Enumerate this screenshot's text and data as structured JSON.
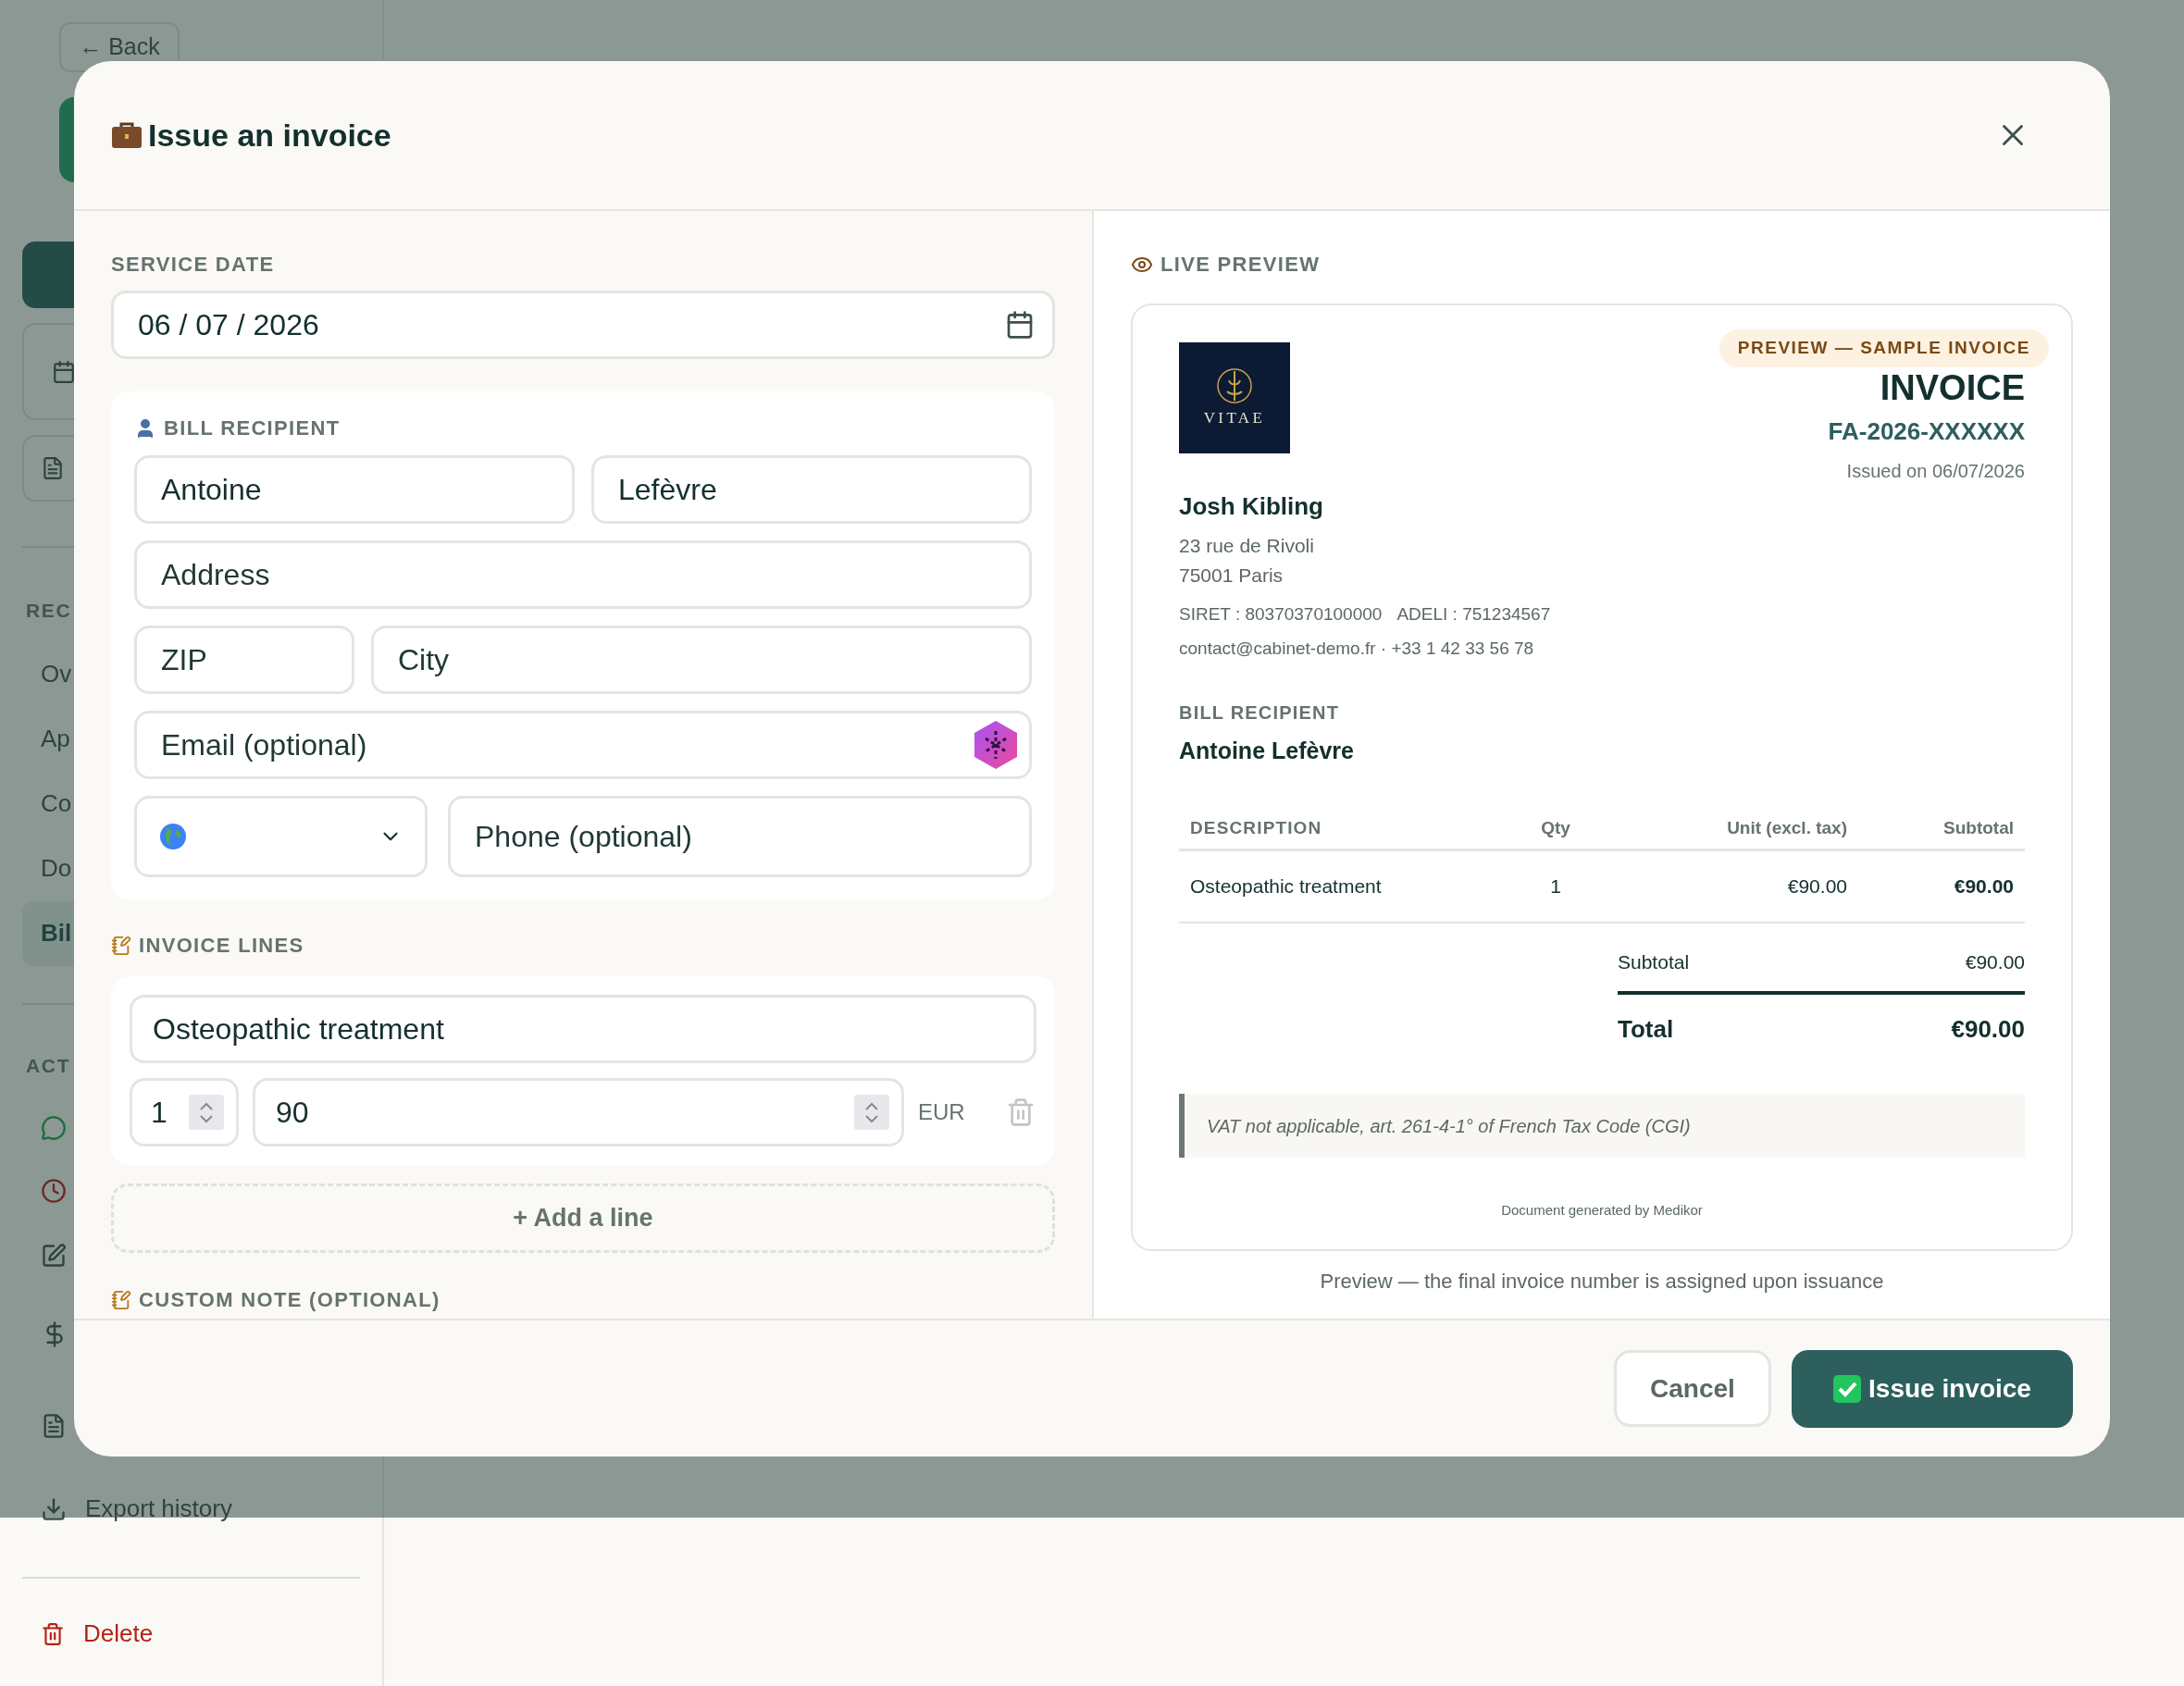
{
  "background": {
    "back_button": "← Back",
    "sections": [
      {
        "heading": "REC",
        "items": [
          {
            "label": "Ov",
            "selected": false
          },
          {
            "label": "Ap",
            "selected": false
          },
          {
            "label": "Co",
            "selected": false
          },
          {
            "label": "Do",
            "selected": false
          },
          {
            "label": "Bil",
            "selected": true
          }
        ]
      },
      {
        "heading": "ACT"
      }
    ],
    "export_label": "Export history",
    "delete_label": "Delete"
  },
  "dialog": {
    "title": "Issue an invoice",
    "form": {
      "service_date": {
        "label": "SERVICE DATE",
        "value": "06 / 07 / 2026"
      },
      "recipient": {
        "heading": "BILL RECIPIENT",
        "first_name": {
          "value": "Antoine"
        },
        "last_name": {
          "value": "Lefèvre"
        },
        "address": {
          "placeholder": "Address"
        },
        "zip": {
          "placeholder": "ZIP"
        },
        "city": {
          "placeholder": "City"
        },
        "email": {
          "placeholder": "Email (optional)"
        },
        "phone": {
          "placeholder": "Phone (optional)"
        }
      },
      "lines_heading": "INVOICE LINES",
      "lines": [
        {
          "description": "Osteopathic treatment",
          "qty": "1",
          "price": "90",
          "currency": "EUR"
        }
      ],
      "add_line": "+ Add a line",
      "note_heading": "CUSTOM NOTE (OPTIONAL)"
    },
    "preview": {
      "heading": "LIVE PREVIEW",
      "logo_text": "VITAE",
      "badge": "PREVIEW — SAMPLE INVOICE",
      "title": "INVOICE",
      "number": "FA-2026-XXXXXX",
      "issued": "Issued on 06/07/2026",
      "practitioner": {
        "name": "Josh Kibling",
        "address_lines": [
          "23 rue de Rivoli",
          "75001 Paris"
        ],
        "ids": [
          "SIRET : 80370370100000",
          "ADELI : 751234567"
        ],
        "contact": "contact@cabinet-demo.fr · +33 1 42 33 56 78"
      },
      "recipient": {
        "heading": "BILL RECIPIENT",
        "name": "Antoine Lefèvre"
      },
      "table": {
        "columns": [
          "DESCRIPTION",
          "Qty",
          "Unit (excl. tax)",
          "Subtotal"
        ],
        "rows": [
          [
            "Osteopathic treatment",
            "1",
            "€90.00",
            "€90.00"
          ]
        ]
      },
      "totals": [
        {
          "kind": "subtotal",
          "label": "Subtotal",
          "value": "€90.00"
        },
        {
          "kind": "total",
          "label": "Total",
          "value": "€90.00"
        }
      ],
      "note": "VAT not applicable, art. 261-4-1° of French Tax Code (CGI)",
      "generated_by": "Document generated by Medikor"
    },
    "preview_caption": "Preview — the final invoice number is assigned upon issuance",
    "buttons": {
      "cancel": "Cancel",
      "issue": "Issue invoice"
    }
  }
}
